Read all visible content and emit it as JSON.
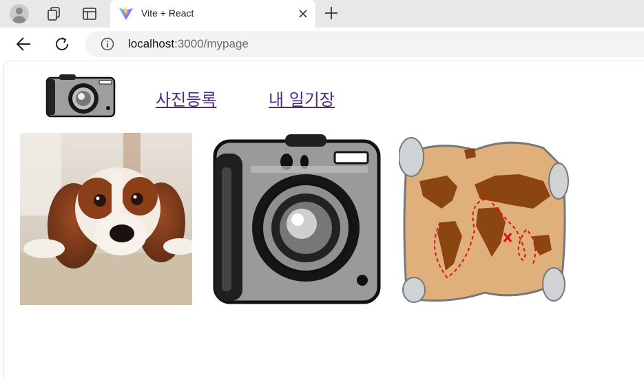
{
  "browser": {
    "tab_title": "Vite + React",
    "url_host": "localhost",
    "url_path": ":3000/mypage"
  },
  "nav": {
    "upload_label": "사진등록",
    "diary_label": "내 일기장"
  },
  "gallery": [
    {
      "name": "dog-photo"
    },
    {
      "name": "camera-photo"
    },
    {
      "name": "treasure-map-photo"
    }
  ]
}
